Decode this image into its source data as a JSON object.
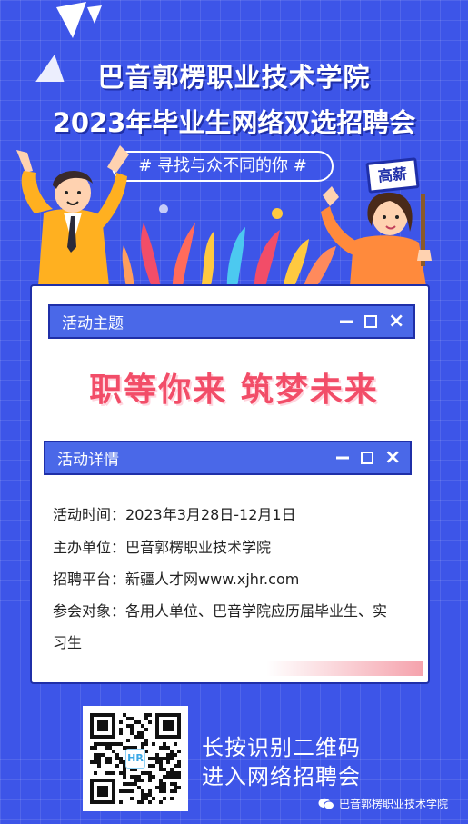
{
  "header": {
    "title_line1": "巴音郭楞职业技术学院",
    "title_line2": "2023年毕业生网络双选招聘会",
    "slogan": "# 寻找与众不同的你 #",
    "sign_text": "高薪"
  },
  "theme_window": {
    "label": "活动主题",
    "controls": [
      "—",
      "□",
      "×"
    ],
    "headline": "职等你来 筑梦未来"
  },
  "detail_window": {
    "label": "活动详情",
    "rows": [
      {
        "key": "活动时间：",
        "value": "2023年3月28日-12月1日"
      },
      {
        "key": "主办单位：",
        "value": "巴音郭楞职业技术学院"
      },
      {
        "key": "招聘平台：",
        "value": "新疆人才网www.xjhr.com"
      },
      {
        "key": "参会对象：",
        "value": "各用人单位、巴音学院应历届毕业生、实"
      }
    ],
    "wrap_line": "习生"
  },
  "bottom": {
    "qr_logo": "HR",
    "cta_line1": "长按识别二维码",
    "cta_line2": "进入网络招聘会",
    "brand": "巴音郭楞职业技术学院"
  },
  "colors": {
    "background": "#3d55e8",
    "accent_pink": "#f24d68",
    "highlight_yellow": "#ffc940",
    "window_bar": "#4a68e8"
  }
}
